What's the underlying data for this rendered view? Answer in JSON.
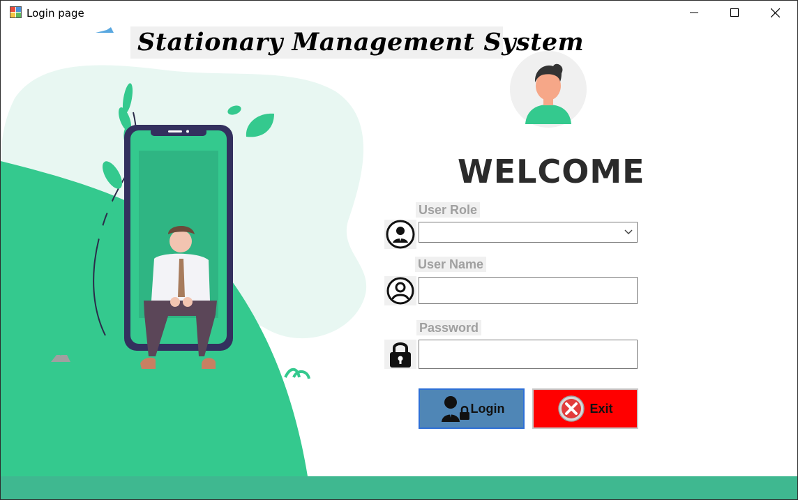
{
  "window": {
    "title": "Login page",
    "controls": {
      "minimize": "minimize",
      "maximize": "maximize",
      "close": "close"
    }
  },
  "app": {
    "title": "Stationary Management System"
  },
  "form": {
    "welcome": "WELCOME",
    "user_role": {
      "label": "User Role",
      "value": "",
      "options": []
    },
    "user_name": {
      "label": "User Name",
      "value": "",
      "placeholder": ""
    },
    "password": {
      "label": "Password",
      "value": "",
      "placeholder": ""
    },
    "login_label": "Login",
    "exit_label": "Exit"
  },
  "colors": {
    "accent_green": "#34c98e",
    "login_blue": "#4f86b6",
    "exit_red": "#ff0000",
    "text_dark": "#2b2b2b",
    "label_gray": "#a0a0a0"
  },
  "icons": {
    "app": "window-app-icon",
    "role": "businessman-icon",
    "user": "user-circle-icon",
    "password": "lock-icon",
    "login": "user-lock-icon",
    "exit": "close-circle-icon",
    "dropdown": "chevron-down-icon"
  }
}
